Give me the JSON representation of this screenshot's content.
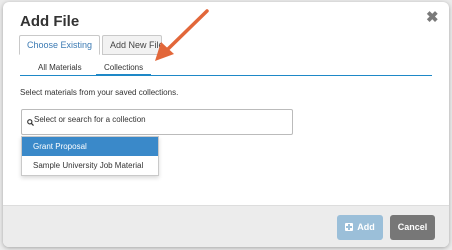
{
  "dialog": {
    "title": "Add File",
    "close_glyph": "✖"
  },
  "tabs": [
    {
      "label": "Choose Existing",
      "active": true
    },
    {
      "label": "Add New File",
      "active": false
    }
  ],
  "subtabs": [
    {
      "label": "All Materials",
      "active": false
    },
    {
      "label": "Collections",
      "active": true
    }
  ],
  "help_text": "Select materials from your saved collections.",
  "search": {
    "placeholder": "Select or search for a collection",
    "icon": "search-icon"
  },
  "dropdown": {
    "options": [
      {
        "label": "Grant Proposal",
        "selected": true
      },
      {
        "label": "Sample University Job Material",
        "selected": false
      }
    ]
  },
  "footer": {
    "add_label": "Add",
    "cancel_label": "Cancel"
  },
  "colors": {
    "accent": "#1e88c7",
    "selected_option": "#3a89c9",
    "annotation_arrow": "#e2673a",
    "add_button": "#9bbfd9",
    "cancel_button": "#777777"
  }
}
